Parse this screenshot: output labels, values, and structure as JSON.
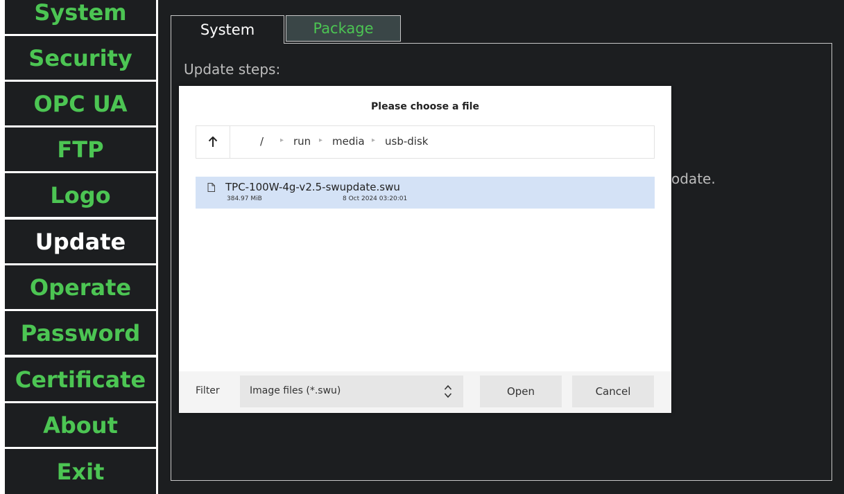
{
  "sidebar": {
    "items": [
      {
        "label": "System",
        "active": false
      },
      {
        "label": "Security",
        "active": false
      },
      {
        "label": "OPC UA",
        "active": false
      },
      {
        "label": "FTP",
        "active": false
      },
      {
        "label": "Logo",
        "active": false
      },
      {
        "label": "Update",
        "active": true
      },
      {
        "label": "Operate",
        "active": false
      },
      {
        "label": "Password",
        "active": false
      },
      {
        "label": "Certificate",
        "active": false
      },
      {
        "label": "About",
        "active": false
      },
      {
        "label": "Exit",
        "active": false
      }
    ]
  },
  "tabs": [
    {
      "label": "System",
      "selected": true
    },
    {
      "label": "Package",
      "selected": false
    }
  ],
  "main": {
    "update_steps_label": "Update steps:",
    "partial_text": "odate."
  },
  "dialog": {
    "title": "Please choose a file",
    "path": [
      "/",
      "run",
      "media",
      "usb-disk"
    ],
    "files": [
      {
        "name": "TPC-100W-4g-v2.5-swupdate.swu",
        "size": "384.97 MiB",
        "date": "8 Oct 2024 03:20:01"
      }
    ],
    "filter_label": "Filter",
    "filter_value": "Image files (*.swu)",
    "open_label": "Open",
    "cancel_label": "Cancel"
  },
  "colors": {
    "sidebar_bg": "#1c1e20",
    "accent_green": "#4cc553",
    "selected_row": "#d4e2f6"
  },
  "icons": {
    "up": "arrow-up-icon",
    "file": "file-icon",
    "filter_toggle": "chevron-up-down-icon",
    "crumb_separator": "chevron-right-icon"
  }
}
